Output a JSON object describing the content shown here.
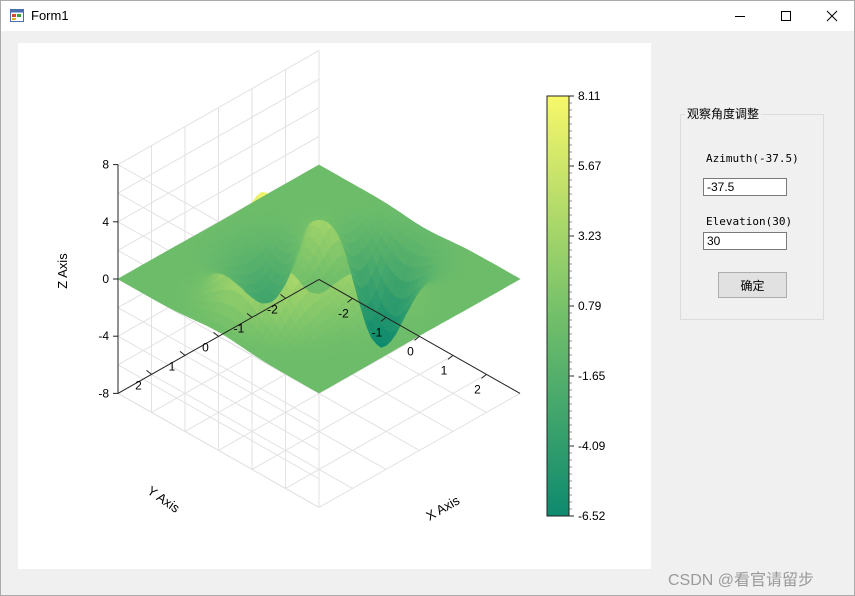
{
  "window": {
    "title": "Form1"
  },
  "chart_data": {
    "type": "surface",
    "title": "",
    "xlabel": "X Axis",
    "ylabel": "Y Axis",
    "zlabel": "Z Axis",
    "xlim": [
      -3,
      3
    ],
    "ylim": [
      -3,
      3
    ],
    "zlim": [
      -8,
      8
    ],
    "x_ticks": [
      "-2",
      "-1",
      "0",
      "1",
      "2"
    ],
    "y_ticks": [
      "2",
      "1",
      "0",
      "-1",
      "-2"
    ],
    "z_ticks": [
      "8",
      "4",
      "0",
      "-4",
      "-8"
    ],
    "colorbar": {
      "min": -6.52,
      "max": 8.11,
      "tick_labels": [
        "8.11",
        "5.67",
        "3.23",
        "0.79",
        "-1.65",
        "-4.09",
        "-6.52"
      ]
    },
    "view": {
      "azimuth": -37.5,
      "elevation": 30
    },
    "surface": "peaks",
    "colors": {
      "low": "#0d8a6e",
      "mid": "#78c26a",
      "high": "#f8f86a"
    },
    "grid": true
  },
  "panel": {
    "group_title": "观察角度调整",
    "azimuth_label": "Azimuth(-37.5)",
    "azimuth_value": "-37.5",
    "elevation_label": "Elevation(30)",
    "elevation_value": "30",
    "ok_label": "确定"
  },
  "watermark": "CSDN @看官请留步"
}
